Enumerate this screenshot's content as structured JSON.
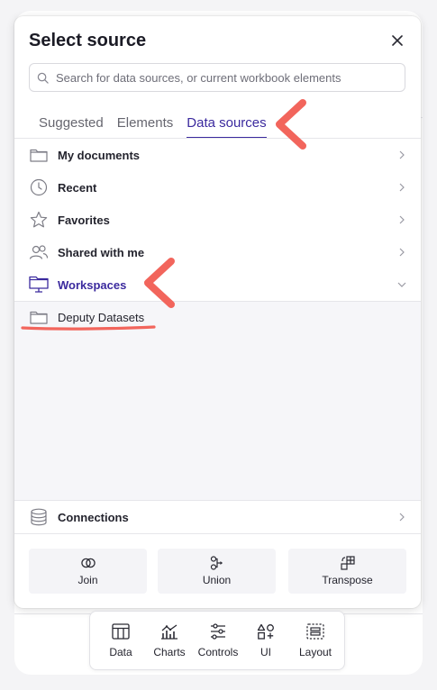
{
  "dialog": {
    "title": "Select source",
    "search_placeholder": "Search for data sources, or current workbook elements"
  },
  "tabs": [
    {
      "label": "Suggested",
      "active": false
    },
    {
      "label": "Elements",
      "active": false
    },
    {
      "label": "Data sources",
      "active": true
    }
  ],
  "sources": [
    {
      "label": "My documents",
      "icon": "folder-icon"
    },
    {
      "label": "Recent",
      "icon": "clock-icon"
    },
    {
      "label": "Favorites",
      "icon": "star-icon"
    },
    {
      "label": "Shared with me",
      "icon": "users-icon"
    },
    {
      "label": "Workspaces",
      "icon": "workspace-icon",
      "expanded": true
    }
  ],
  "workspaces_children": [
    {
      "label": "Deputy Datasets",
      "icon": "folder-icon"
    }
  ],
  "connections": {
    "label": "Connections",
    "icon": "database-icon"
  },
  "actions": [
    {
      "label": "Join",
      "icon": "join-icon"
    },
    {
      "label": "Union",
      "icon": "union-icon"
    },
    {
      "label": "Transpose",
      "icon": "transpose-icon"
    }
  ],
  "toolbar": [
    {
      "label": "Data",
      "icon": "table-icon"
    },
    {
      "label": "Charts",
      "icon": "chart-icon"
    },
    {
      "label": "Controls",
      "icon": "sliders-icon"
    },
    {
      "label": "UI",
      "icon": "shapes-icon"
    },
    {
      "label": "Layout",
      "icon": "layout-icon"
    }
  ],
  "colors": {
    "accent": "#3b2a9e",
    "annotation": "#f2655c"
  }
}
